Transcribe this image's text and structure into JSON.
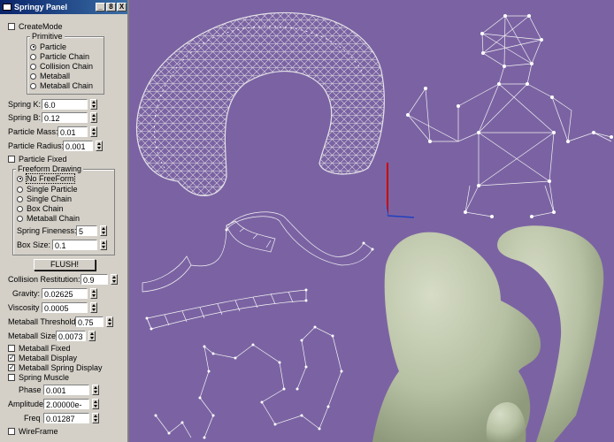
{
  "window": {
    "title": "Springy Panel",
    "buttons": [
      "_",
      "8",
      "X"
    ]
  },
  "panel": {
    "create_mode": {
      "label": "CreateMode",
      "checked": false
    },
    "primitive": {
      "label": "Primitive",
      "options": [
        {
          "label": "Particle",
          "selected": true
        },
        {
          "label": "Particle Chain",
          "selected": false
        },
        {
          "label": "Collision Chain",
          "selected": false
        },
        {
          "label": "Metaball",
          "selected": false
        },
        {
          "label": "Metaball Chain",
          "selected": false
        }
      ]
    },
    "spring_k": {
      "label": "Spring K:",
      "value": "6.0"
    },
    "spring_b": {
      "label": "Spring B:",
      "value": "0.12"
    },
    "particle_mass": {
      "label": "Particle Mass:",
      "value": "0.01"
    },
    "particle_radius": {
      "label": "Particle Radius:",
      "value": "0.001"
    },
    "particle_fixed": {
      "label": "Particle Fixed",
      "checked": false
    },
    "freeform": {
      "label": "Freeform Drawing",
      "options": [
        {
          "label": "No FreeForm",
          "selected": true
        },
        {
          "label": "Single Particle",
          "selected": false
        },
        {
          "label": "Single Chain",
          "selected": false
        },
        {
          "label": "Box Chain",
          "selected": false
        },
        {
          "label": "Metaball Chain",
          "selected": false
        }
      ],
      "spring_fineness": {
        "label": "Spring Fineness:",
        "value": "5"
      },
      "box_size": {
        "label": "Box Size:",
        "value": "0.1"
      }
    },
    "flush_button": "FLUSH!",
    "collision_restitution": {
      "label": "Collision Restitution:",
      "value": "0.9"
    },
    "gravity": {
      "label": "Gravity:",
      "value": "0.02625"
    },
    "viscosity": {
      "label": "Viscosity",
      "value": "0.0005"
    },
    "metaball_threshold": {
      "label": "Metaball Threshold",
      "value": "0.75"
    },
    "metaball_size": {
      "label": "Metaball Size",
      "value": "0.0073"
    },
    "metaball_fixed": {
      "label": "Metaball Fixed",
      "checked": false
    },
    "metaball_display": {
      "label": "Metaball Display",
      "checked": true
    },
    "metaball_spring_display": {
      "label": "Metaball Spring Display",
      "checked": true
    },
    "spring_muscle": {
      "label": "Spring Muscle",
      "checked": false
    },
    "phase": {
      "label": "Phase",
      "value": "0.001"
    },
    "amplitude": {
      "label": "Amplitude",
      "value": "2.00000e-"
    },
    "freq": {
      "label": "Freq",
      "value": "0.01287"
    },
    "wireframe": {
      "label": "WireFrame",
      "checked": false
    }
  },
  "colors": {
    "viewport_bg": "#7b63a3",
    "panel_bg": "#d4d0c8",
    "title_bg": "#0a246a",
    "metaball": "#b9c3a6",
    "wire": "#e8e8e8"
  }
}
